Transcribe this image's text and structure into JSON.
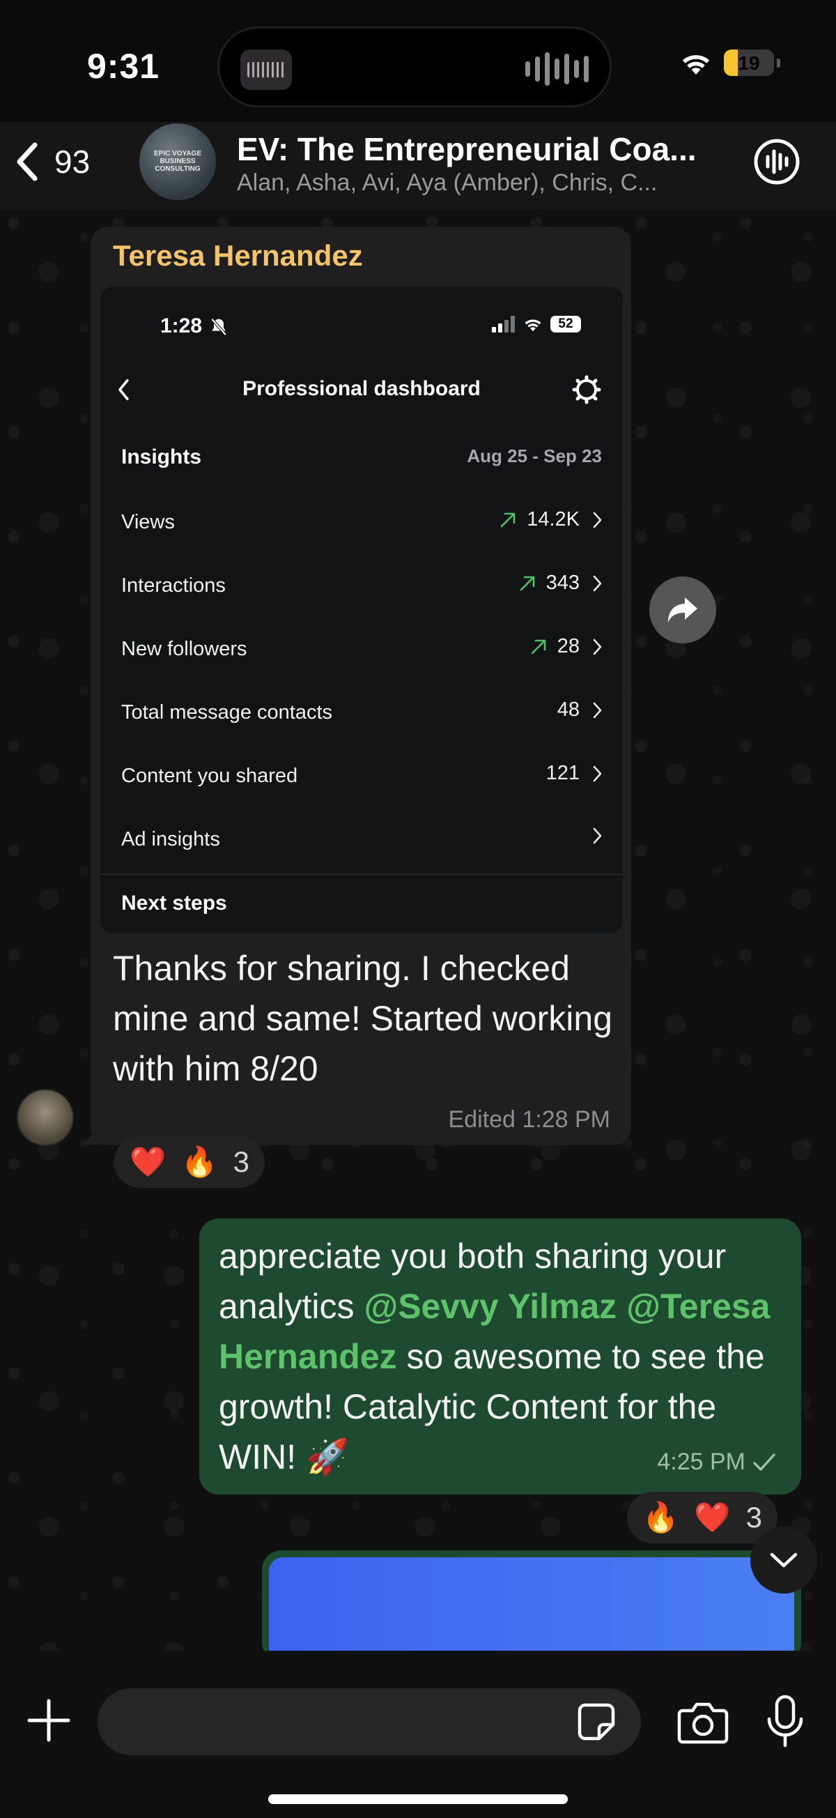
{
  "status_bar": {
    "time": "9:31",
    "battery": "19"
  },
  "header": {
    "back_count": "93",
    "avatar_text": "EPIC VOYAGE BUSINESS CONSULTING",
    "title": "EV: The Entrepreneurial Coa...",
    "subtitle": "Alan, Asha, Avi, Aya (Amber), Chris, C..."
  },
  "incoming": {
    "sender": "Teresa Hernandez",
    "screenshot": {
      "time": "1:28",
      "battery": "52",
      "title": "Professional dashboard",
      "insights_label": "Insights",
      "date_range": "Aug 25 - Sep 23",
      "rows": [
        {
          "label": "Views",
          "value": "14.2K",
          "trend": "up"
        },
        {
          "label": "Interactions",
          "value": "343",
          "trend": "up"
        },
        {
          "label": "New followers",
          "value": "28",
          "trend": "up"
        },
        {
          "label": "Total message contacts",
          "value": "48",
          "trend": ""
        },
        {
          "label": "Content you shared",
          "value": "121",
          "trend": ""
        },
        {
          "label": "Ad insights",
          "value": "",
          "trend": ""
        }
      ],
      "next_steps": "Next steps"
    },
    "text": "Thanks for sharing. I checked mine and same! Started working with him 8/20",
    "meta": "Edited 1:28 PM",
    "reactions": {
      "emoji1": "❤️",
      "emoji2": "🔥",
      "count": "3"
    }
  },
  "outgoing": {
    "text_before": "appreciate you both sharing your analytics ",
    "mention1": "@Sevvy Yilmaz",
    "mention2": "@Teresa Hernandez",
    "text_after": " so awesome to see the growth! Catalytic Content for the WIN! 🚀",
    "time": "4:25 PM",
    "reactions": {
      "emoji1": "🔥",
      "emoji2": "❤️",
      "count": "3"
    }
  },
  "input": {
    "placeholder": ""
  },
  "colors": {
    "accent_green": "#5ec26a",
    "sender_name": "#f4c36a",
    "outgoing_bubble": "#1e4a30"
  }
}
